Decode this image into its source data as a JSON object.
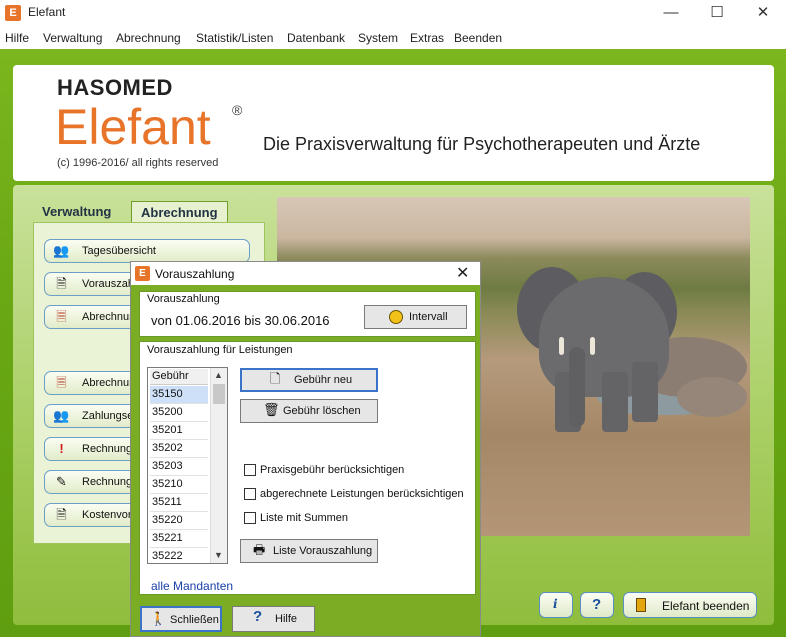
{
  "window": {
    "title": "Elefant",
    "app_icon_letter": "E",
    "controls": {
      "minimize": "—",
      "maximize": "☐",
      "close": "✕"
    }
  },
  "menu": [
    "Hilfe",
    "Verwaltung",
    "Abrechnung",
    "Statistik/Listen",
    "Datenbank",
    "System",
    "Extras",
    "Beenden"
  ],
  "header": {
    "brand_small": "HASOMED",
    "brand_big": "Elefant",
    "registered": "®",
    "copyright": "(c) 1996-2016/ all rights reserved",
    "tagline": "Die Praxisverwaltung für Psychotherapeuten und Ärzte"
  },
  "tabs": [
    {
      "label": "Verwaltung",
      "active": false
    },
    {
      "label": "Abrechnung",
      "active": true
    }
  ],
  "sidebar": {
    "items": [
      {
        "label": "Tagesübersicht",
        "icon": "users-icon"
      },
      {
        "label": "Vorauszahlung",
        "icon": "document-icon"
      },
      {
        "label": "Abrechnung",
        "icon": "invoice-icon"
      },
      {
        "label": "Abrechnung",
        "icon": "invoice-icon"
      },
      {
        "label": "Zahlungseingang",
        "icon": "users-icon"
      },
      {
        "label": "Rechnung",
        "icon": "alert-icon"
      },
      {
        "label": "Rechnung",
        "icon": "pen-icon"
      },
      {
        "label": "Kostenvoranschlag",
        "icon": "document-icon"
      }
    ]
  },
  "bottom_buttons": {
    "info": "i",
    "help": "?",
    "exit_label": "Elefant beenden"
  },
  "dialog": {
    "title": "Vorauszahlung",
    "close": "✕",
    "group1_label": "Vorauszahlung",
    "range_text": "von 01.06.2016  bis 30.06.2016",
    "interval_button": "Intervall",
    "group2_label": "Vorauszahlung für Leistungen",
    "list_header": "Gebühr",
    "list_items": [
      "35150",
      "35200",
      "35201",
      "35202",
      "35203",
      "35210",
      "35211",
      "35220",
      "35221",
      "35222"
    ],
    "selected_index": 0,
    "new_fee_button": "Gebühr neu",
    "delete_fee_button": "Gebühr löschen",
    "checkboxes": [
      {
        "label": "Praxisgebühr berücksichtigen",
        "checked": false
      },
      {
        "label": "abgerechnete Leistungen berücksichtigen",
        "checked": false
      },
      {
        "label": "Liste mit Summen",
        "checked": false
      }
    ],
    "list_button": "Liste Vorauszahlung",
    "all_clients_link": "alle Mandanten",
    "close_button": "Schließen",
    "help_button": "Hilfe"
  }
}
